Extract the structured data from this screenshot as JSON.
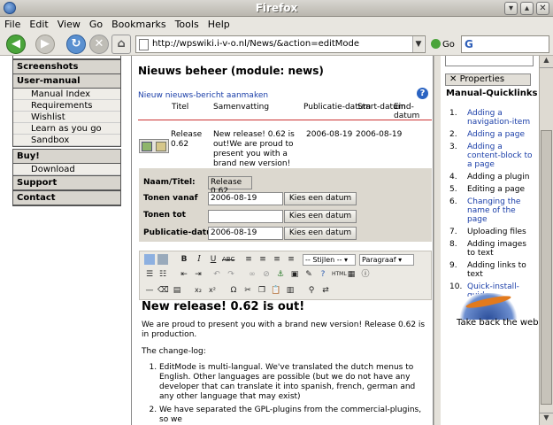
{
  "window": {
    "title": "Firefox",
    "min": "▾",
    "max": "▴",
    "close": "✕"
  },
  "menubar": [
    "File",
    "Edit",
    "View",
    "Go",
    "Bookmarks",
    "Tools",
    "Help"
  ],
  "nav": {
    "url": "http://wpswiki.i-v-o.nl/News/&action=editMode",
    "go_label": "Go",
    "search_logo": "G"
  },
  "sidebar": {
    "sections": [
      {
        "title": "Screenshots",
        "items": []
      },
      {
        "title": "User-manual",
        "items": [
          "Manual Index",
          "Requirements",
          "Wishlist",
          "Learn as you go",
          "Sandbox"
        ]
      },
      {
        "title": "Buy!",
        "items": [
          "Download"
        ]
      },
      {
        "title": "Support",
        "items": []
      },
      {
        "title": "Contact",
        "items": []
      }
    ]
  },
  "main": {
    "heading": "Nieuws beheer (module: news)",
    "new_link": "Nieuw nieuws-bericht aanmaken",
    "columns": [
      "Titel",
      "Samenvatting",
      "Publicatie-datum",
      "Start-datum",
      "Eind-datum"
    ],
    "row": {
      "title": "Release 0.62",
      "summary": "New release! 0.62 is out!We are proud to present you with a brand new version! Release 0.62 is in p.....",
      "pub_date": "2006-08-19",
      "start_date": "2006-08-19"
    },
    "form": {
      "name_label": "Naam/Titel:",
      "name_value": "Release 0.62",
      "from_label": "Tonen vanaf",
      "from_value": "2006-08-19",
      "to_label": "Tonen tot",
      "to_value": "",
      "pub_label": "Publicatie-datum",
      "pub_value": "2006-08-19",
      "pick_date_label": "Kies een datum"
    },
    "toolbar": {
      "style_select": "-- Stijlen --",
      "format_select": "Paragraaf"
    },
    "editor": {
      "heading": "New release! 0.62 is out!",
      "p1": "We are proud to present you with a brand new version! Release 0.62 is in production.",
      "p2": "The change-log:",
      "items": [
        "EditMode is multi-langual. We've translated the dutch menus to English. Other languages are possible (but we do not have any developer that can translate it into spanish, french, german and any other language that may exist)",
        "We have separated the GPL-plugins from the commercial-plugins, so we"
      ]
    }
  },
  "right": {
    "properties_label": "Properties",
    "quicklinks_title": "Manual-Quicklinks",
    "quicklinks": [
      {
        "n": "1.",
        "label": "Adding a navigation-item",
        "link": true
      },
      {
        "n": "2.",
        "label": "Adding a page",
        "link": true
      },
      {
        "n": "3.",
        "label": "Adding a content-block to a page",
        "link": true
      },
      {
        "n": "4.",
        "label": "Adding a plugin",
        "link": false
      },
      {
        "n": "5.",
        "label": "Editing a page",
        "link": false
      },
      {
        "n": "6.",
        "label": "Changing the name of the page",
        "link": true
      },
      {
        "n": "7.",
        "label": "Uploading files",
        "link": false
      },
      {
        "n": "8.",
        "label": "Adding images to text",
        "link": false
      },
      {
        "n": "9.",
        "label": "Adding links to text",
        "link": false
      },
      {
        "n": "10.",
        "label": "Quick-install-guide",
        "link": true
      }
    ],
    "tagline": "Take back the web"
  }
}
